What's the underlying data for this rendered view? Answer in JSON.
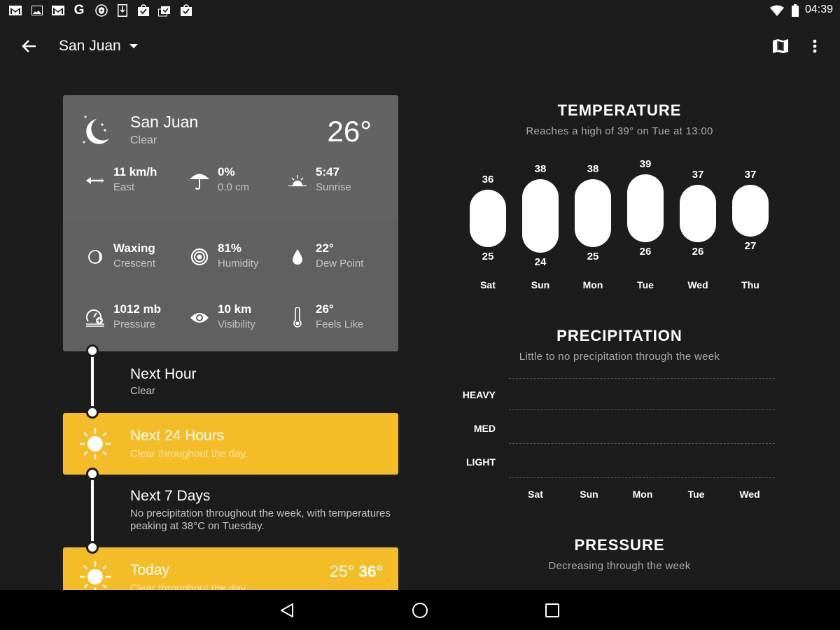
{
  "status_bar": {
    "notification_icons": [
      "gmail-icon",
      "photo-icon",
      "gmail-icon",
      "google-icon",
      "vpn-shield-icon",
      "download-icon",
      "play-store-check-icon",
      "play-store-multi-check-icon",
      "play-store-check-icon"
    ],
    "wifi": "wifi-icon",
    "battery": "battery-icon",
    "time": "04:39"
  },
  "app_bar": {
    "location": "San Juan",
    "back_icon": "arrow-back-icon",
    "dropdown_icon": "caret-down-icon",
    "map_icon": "map-icon",
    "menu_icon": "more-vert-icon"
  },
  "current": {
    "city": "San Juan",
    "condition": "Clear",
    "temperature": "26°",
    "icon": "moon-stars-icon",
    "stats": [
      {
        "icon": "wind-arrow-icon",
        "value": "11 km/h",
        "label": "East"
      },
      {
        "icon": "umbrella-icon",
        "value": "0%",
        "label": "0.0 cm"
      },
      {
        "icon": "sunrise-icon",
        "value": "5:47",
        "label": "Sunrise"
      },
      {
        "icon": "moon-phase-icon",
        "value": "Waxing",
        "label": "Crescent"
      },
      {
        "icon": "humidity-icon",
        "value": "81%",
        "label": "Humidity"
      },
      {
        "icon": "water-drop-icon",
        "value": "22°",
        "label": "Dew Point"
      },
      {
        "icon": "barometer-icon",
        "value": "1012 mb",
        "label": "Pressure"
      },
      {
        "icon": "eye-icon",
        "value": "10 km",
        "label": "Visibility"
      },
      {
        "icon": "thermometer-icon",
        "value": "26°",
        "label": "Feels Like"
      }
    ]
  },
  "timeline": [
    {
      "title": "Next Hour",
      "subtitle": "Clear"
    },
    {
      "title": "Next 24 Hours",
      "subtitle": "Clear throughout the day.",
      "icon": "sun-icon"
    },
    {
      "title": "Next 7 Days",
      "subtitle": "No precipitation throughout the week, with temperatures peaking at 38°C on Tuesday."
    },
    {
      "title": "Today",
      "subtitle": "Clear throughout the day.",
      "icon": "sun-icon",
      "low": "25°",
      "high": "36°"
    }
  ],
  "temperature_panel": {
    "title": "TEMPERATURE",
    "subtitle": "Reaches a high of 39° on Tue at 13:00"
  },
  "precipitation_panel": {
    "title": "PRECIPITATION",
    "subtitle": "Little to no precipitation through the week"
  },
  "pressure_panel": {
    "title": "PRESSURE",
    "subtitle": "Decreasing through the week"
  },
  "chart_data": [
    {
      "type": "bar",
      "title": "TEMPERATURE",
      "subtitle": "Reaches a high of 39° on Tue at 13:00",
      "categories": [
        "Sat",
        "Sun",
        "Mon",
        "Tue",
        "Wed",
        "Thu"
      ],
      "series": [
        {
          "name": "high",
          "values": [
            36,
            38,
            38,
            39,
            37,
            37
          ]
        },
        {
          "name": "low",
          "values": [
            25,
            24,
            25,
            26,
            26,
            27
          ]
        }
      ],
      "xlabel": "",
      "ylabel": ""
    },
    {
      "type": "bar",
      "title": "PRECIPITATION",
      "subtitle": "Little to no precipitation through the week",
      "categories": [
        "Sat",
        "Sun",
        "Mon",
        "Tue",
        "Wed"
      ],
      "y_levels": [
        "HEAVY",
        "MED",
        "LIGHT"
      ],
      "values": [
        0,
        0,
        0,
        0,
        0
      ],
      "grid": true
    }
  ],
  "nav_bar": {
    "back": "nav-back-icon",
    "home": "nav-home-icon",
    "recents": "nav-recents-icon"
  }
}
